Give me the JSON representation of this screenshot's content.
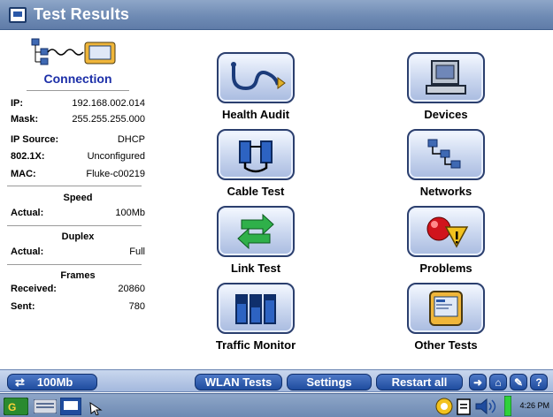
{
  "window": {
    "title": "Test Results"
  },
  "connection": {
    "title": "Connection",
    "fields": [
      {
        "label": "IP:",
        "value": "192.168.002.014"
      },
      {
        "label": "Mask:",
        "value": "255.255.255.000"
      },
      {
        "label": "IP Source:",
        "value": "DHCP"
      },
      {
        "label": "802.1X:",
        "value": "Unconfigured"
      },
      {
        "label": "MAC:",
        "value": "Fluke-c00219"
      }
    ],
    "speed": {
      "heading": "Speed",
      "label": "Actual:",
      "value": "100Mb"
    },
    "duplex": {
      "heading": "Duplex",
      "label": "Actual:",
      "value": "Full"
    },
    "frames": {
      "heading": "Frames",
      "received_label": "Received:",
      "received_value": "20860",
      "sent_label": "Sent:",
      "sent_value": "780"
    }
  },
  "tests": [
    {
      "label": "Health Audit",
      "icon": "stethoscope-icon"
    },
    {
      "label": "Devices",
      "icon": "computer-icon"
    },
    {
      "label": "Cable Test",
      "icon": "cable-icon"
    },
    {
      "label": "Networks",
      "icon": "network-icon"
    },
    {
      "label": "Link Test",
      "icon": "link-arrows-icon"
    },
    {
      "label": "Problems",
      "icon": "problems-icon"
    },
    {
      "label": "Traffic Monitor",
      "icon": "traffic-bars-icon"
    },
    {
      "label": "Other Tests",
      "icon": "other-tests-icon"
    }
  ],
  "statusbar": {
    "link_speed": "100Mb",
    "wlan_tests": "WLAN Tests",
    "settings": "Settings",
    "restart_all": "Restart all",
    "help": "?"
  },
  "taskbar": {
    "time": "4:26 PM"
  },
  "colors": {
    "title_bar": "#6f8bb4",
    "accent_blue": "#1f4c9e",
    "connection_title": "#1c2fa8"
  }
}
